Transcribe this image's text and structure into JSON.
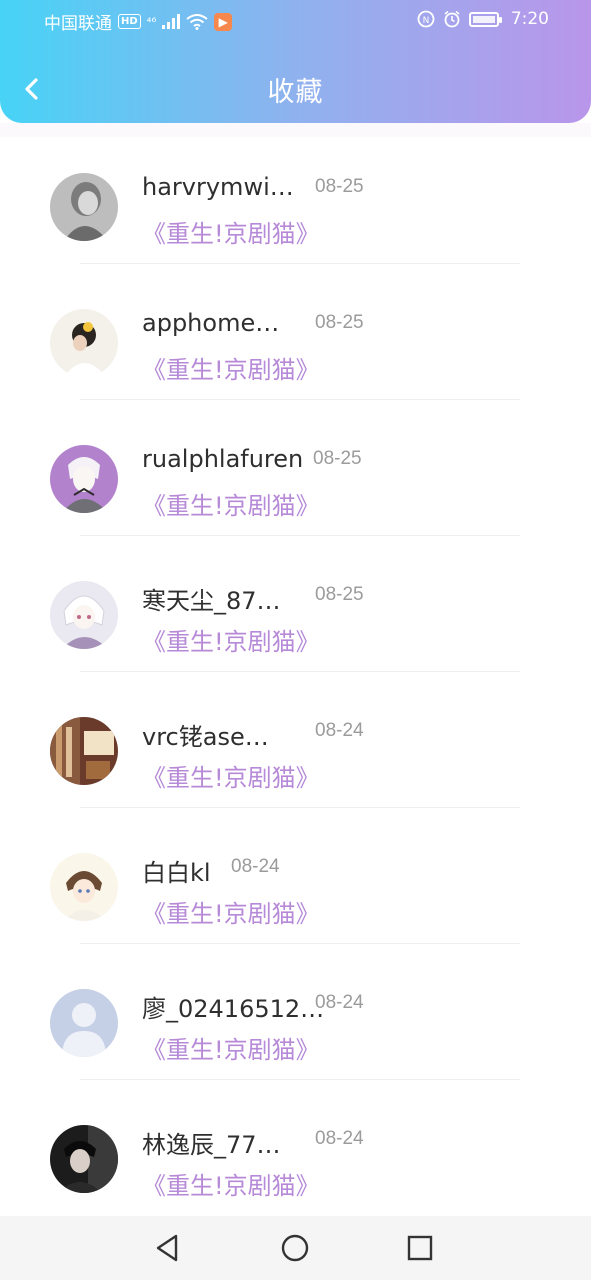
{
  "status_bar": {
    "carrier": "中国联通",
    "hd": "HD",
    "signal": "⁴⁶",
    "app_badge": "▶",
    "time": "7:20"
  },
  "header": {
    "title": "收藏"
  },
  "colors": {
    "gradient_start": "#47d3f6",
    "gradient_end": "#b996ea",
    "accent": "#b78ad8"
  },
  "items": [
    {
      "username": "harvrymwi…",
      "date": "08-25",
      "work": "《重生!京剧猫》",
      "avatar": "avatar-grayscale-girl"
    },
    {
      "username": "apphome…",
      "date": "08-25",
      "work": "《重生!京剧猫》",
      "avatar": "avatar-girl-flower"
    },
    {
      "username": "rualphlafuren",
      "date": "08-25",
      "work": "《重生!京剧猫》",
      "avatar": "avatar-anime-purple"
    },
    {
      "username": "寒天尘_87…",
      "date": "08-25",
      "work": "《重生!京剧猫》",
      "avatar": "avatar-anime-white-hair"
    },
    {
      "username": "vrc铑ase…",
      "date": "08-24",
      "work": "《重生!京剧猫》",
      "avatar": "avatar-room-photo"
    },
    {
      "username": "白白kl",
      "date": "08-24",
      "work": "《重生!京剧猫》",
      "avatar": "avatar-anime-boy"
    },
    {
      "username": "廖_02416512…",
      "date": "08-24",
      "work": "《重生!京剧猫》",
      "avatar": "avatar-default-person"
    },
    {
      "username": "林逸辰_77…",
      "date": "08-24",
      "work": "《重生!京剧猫》",
      "avatar": "avatar-dark-photo"
    }
  ]
}
